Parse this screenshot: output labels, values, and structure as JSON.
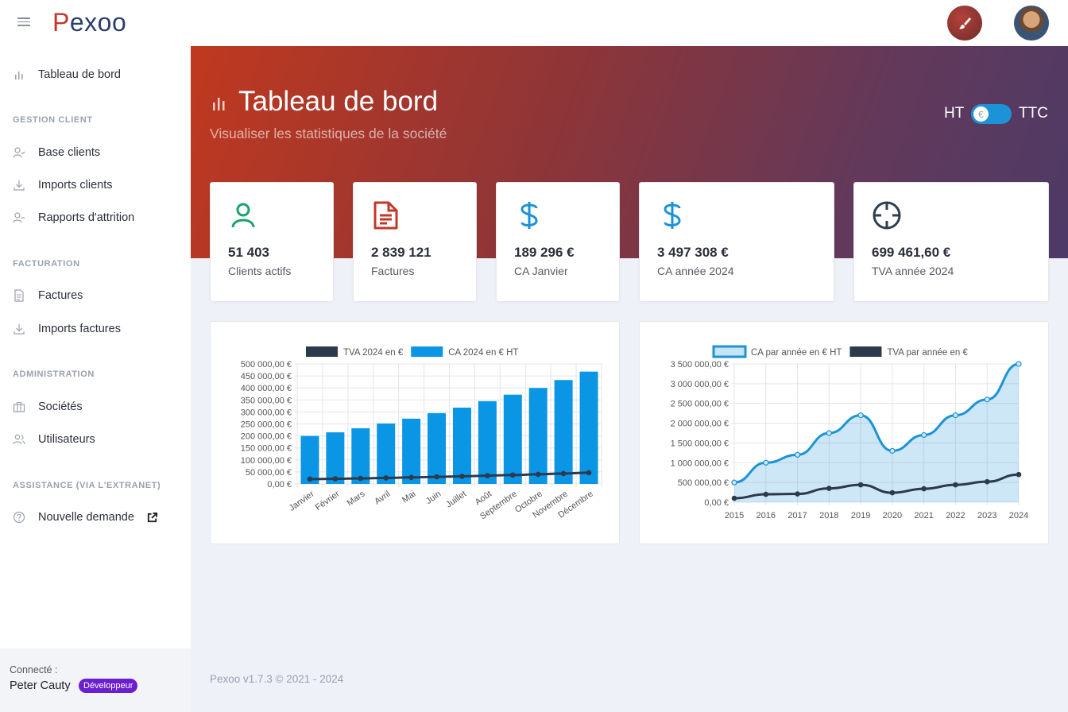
{
  "app": {
    "logo_first": "P",
    "logo_rest": "exoo"
  },
  "sidebar": {
    "items": [
      {
        "label": "Tableau de bord"
      },
      {
        "label": "Base clients"
      },
      {
        "label": "Imports clients"
      },
      {
        "label": "Rapports d'attrition"
      },
      {
        "label": "Factures"
      },
      {
        "label": "Imports factures"
      },
      {
        "label": "Sociétés"
      },
      {
        "label": "Utilisateurs"
      },
      {
        "label": "Nouvelle demande"
      }
    ],
    "sections": {
      "client": "GESTION CLIENT",
      "facturation": "FACTURATION",
      "admin": "ADMINISTRATION",
      "assistance": "ASSISTANCE (VIA L'EXTRANET)"
    },
    "connected_label": "Connecté :",
    "user_name": "Peter Cauty",
    "user_role": "Développeur"
  },
  "hero": {
    "title": "Tableau de bord",
    "subtitle": "Visualiser les statistiques de la société",
    "toggle_left": "HT",
    "toggle_right": "TTC",
    "toggle_knob": "€",
    "toggle_state": "HT"
  },
  "stats": [
    {
      "icon": "user-icon",
      "value": "51 403",
      "label": "Clients actifs",
      "color": "#1aa36a"
    },
    {
      "icon": "document-icon",
      "value": "2 839 121",
      "label": "Factures",
      "color": "#c0392b"
    },
    {
      "icon": "dollar-icon",
      "value": "189 296 €",
      "label": "CA Janvier",
      "color": "#1b93d6"
    },
    {
      "icon": "dollar-icon",
      "value": "3 497 308 €",
      "label": "CA année 2024",
      "color": "#1b93d6"
    },
    {
      "icon": "crosshair-icon",
      "value": "699 461,60 €",
      "label": "TVA année 2024",
      "color": "#2c3e50"
    }
  ],
  "footer": "Pexoo v1.7.3 © 2021 - 2024",
  "chart_data": [
    {
      "type": "bar",
      "categories": [
        "Janvier",
        "Février",
        "Mars",
        "Avril",
        "Mai",
        "Juin",
        "Juillet",
        "Août",
        "Septembre",
        "Octobre",
        "Novembre",
        "Décembre"
      ],
      "series": [
        {
          "name": "CA 2024 en € HT",
          "type": "bar",
          "color": "#0a95e5",
          "values": [
            200000,
            215000,
            232000,
            252000,
            272000,
            295000,
            318000,
            345000,
            372000,
            400000,
            433000,
            468000
          ]
        },
        {
          "name": "TVA 2024 en €",
          "type": "line",
          "color": "#2b3a4d",
          "values": [
            20000,
            21500,
            23200,
            25200,
            27200,
            29500,
            31800,
            34500,
            37200,
            40000,
            43300,
            46800
          ]
        }
      ],
      "yticks": [
        "0,00 €",
        "50 000,00 €",
        "100 000,00 €",
        "150 000,00 €",
        "200 000,00 €",
        "250 000,00 €",
        "300 000,00 €",
        "350 000,00 €",
        "400 000,00 €",
        "450 000,00 €",
        "500 000,00 €"
      ],
      "ylim": [
        0,
        500000
      ],
      "legend": "top",
      "grid": true
    },
    {
      "type": "area",
      "categories": [
        "2015",
        "2016",
        "2017",
        "2018",
        "2019",
        "2020",
        "2021",
        "2022",
        "2023",
        "2024"
      ],
      "series": [
        {
          "name": "CA par année en € HT",
          "type": "area",
          "color": "#1b93d6",
          "values": [
            500000,
            1000000,
            1200000,
            1750000,
            2200000,
            1300000,
            1700000,
            2200000,
            2600000,
            3500000
          ]
        },
        {
          "name": "TVA par année en €",
          "type": "line",
          "color": "#2b3a4d",
          "values": [
            100000,
            200000,
            210000,
            350000,
            440000,
            240000,
            340000,
            440000,
            520000,
            700000
          ]
        }
      ],
      "yticks": [
        "0,00 €",
        "500 000,00 €",
        "1 000 000,00 €",
        "1 500 000,00 €",
        "2 000 000,00 €",
        "2 500 000,00 €",
        "3 000 000,00 €",
        "3 500 000,00 €"
      ],
      "ylim": [
        0,
        3500000
      ],
      "legend": "top",
      "grid": true
    }
  ]
}
